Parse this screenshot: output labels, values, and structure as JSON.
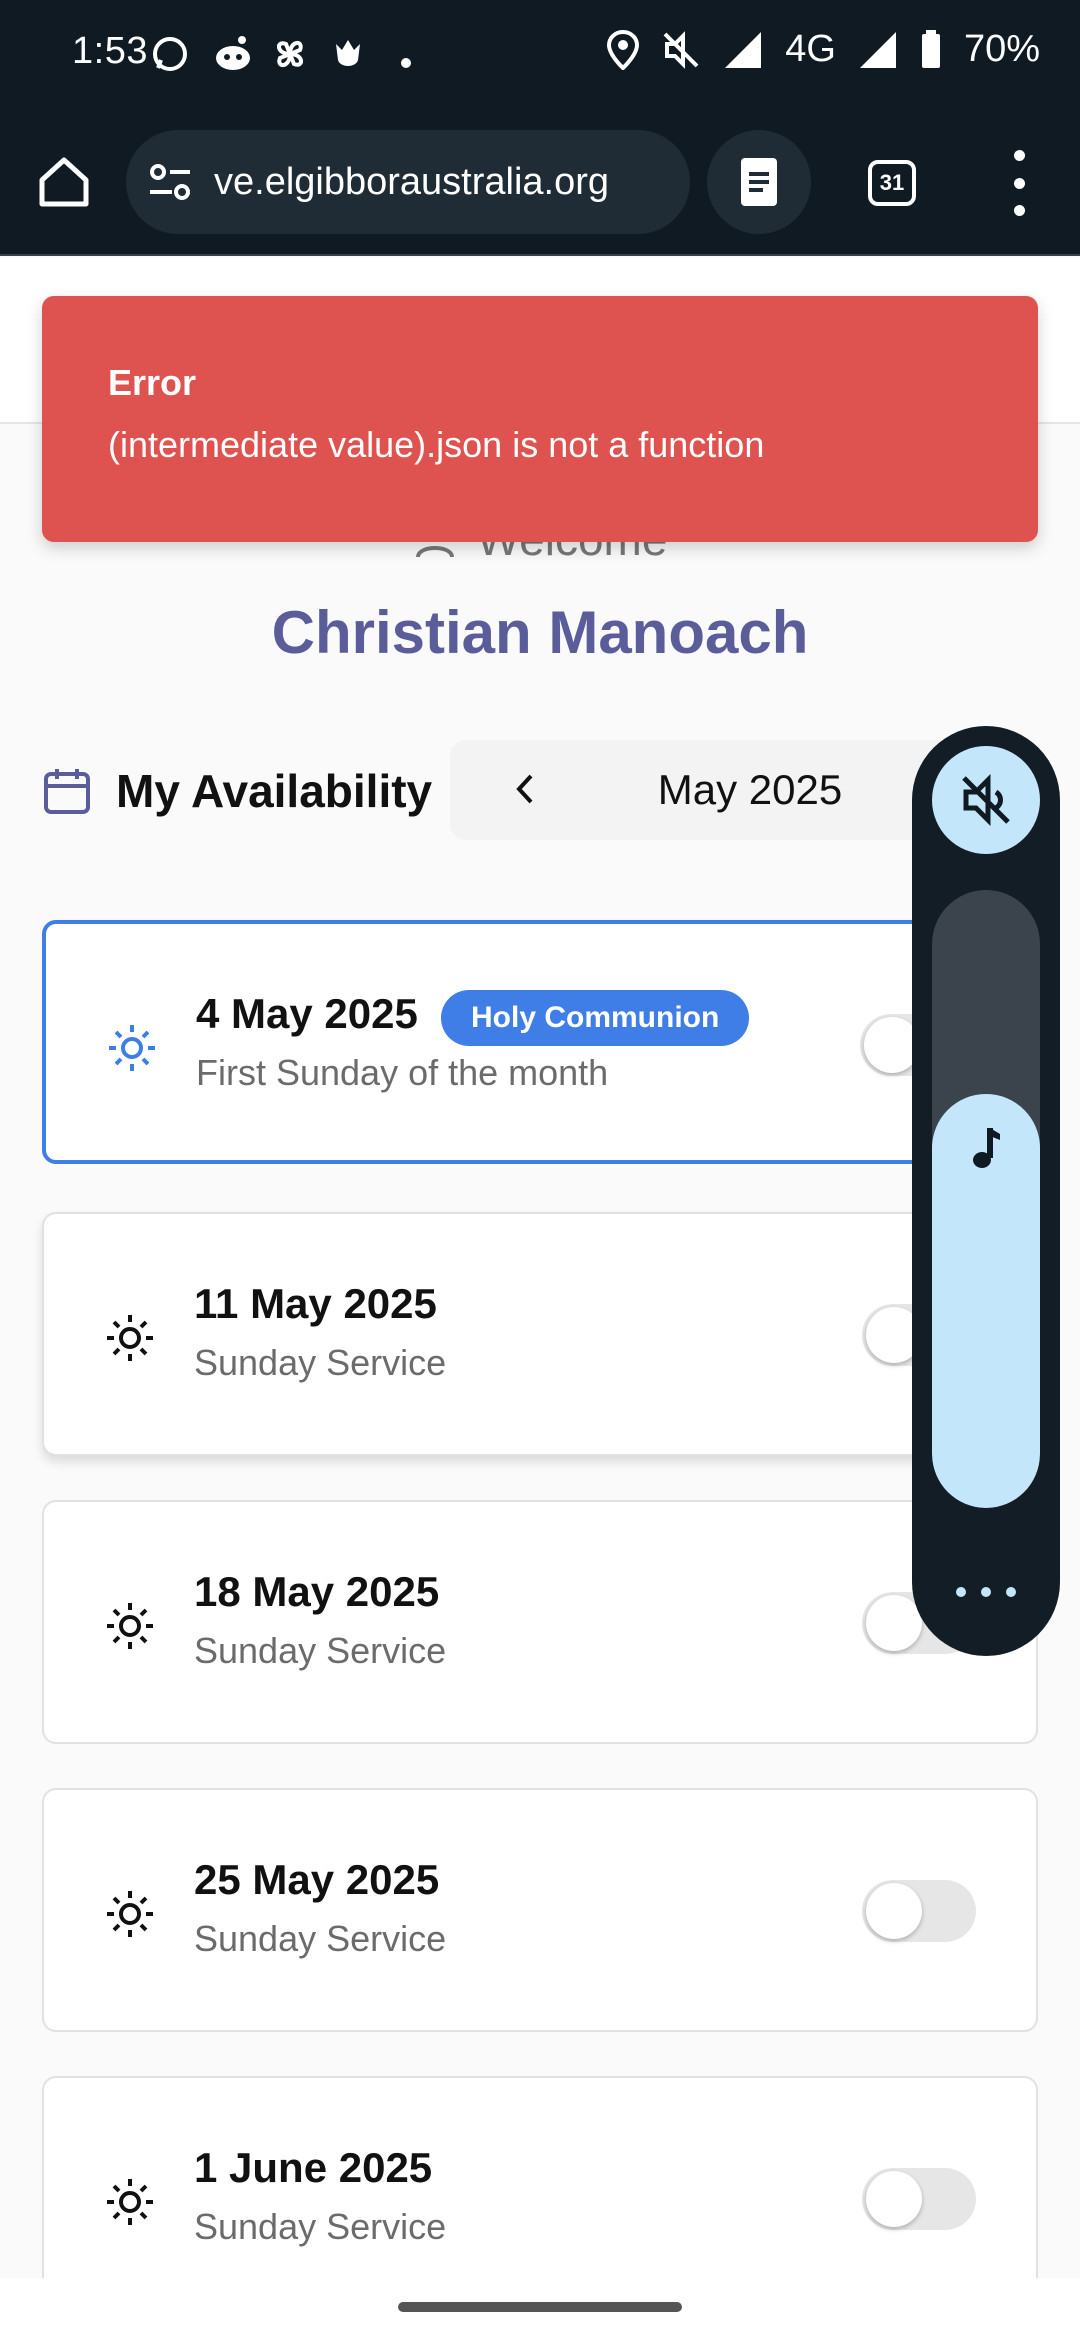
{
  "status_bar": {
    "time": "1:53",
    "network": "4G",
    "battery": "70%",
    "notification_icons": [
      "whatsapp-icon",
      "reddit-icon",
      "pinwheel-icon",
      "bug-icon",
      "dot-icon"
    ],
    "system_icons": [
      "location-icon",
      "vibrate-off-icon",
      "signal-icon",
      "battery-icon"
    ]
  },
  "browser": {
    "url": "ve.elgibboraustralia.org",
    "tab_count": "31"
  },
  "toast": {
    "title": "Error",
    "message": "(intermediate value).json is not a function",
    "color": "#de524f"
  },
  "welcome": {
    "label": "Welcome",
    "name": "Christian Manoach"
  },
  "availability": {
    "title": "My Availability",
    "month": "May 2025"
  },
  "services": [
    {
      "date": "4 May 2025",
      "badge": "Holy Communion",
      "subtitle": "First Sunday of the month",
      "enabled": false,
      "selected": true
    },
    {
      "date": "11 May 2025",
      "subtitle": "Sunday Service",
      "enabled": false,
      "selected": false
    },
    {
      "date": "18 May 2025",
      "subtitle": "Sunday Service",
      "enabled": false,
      "selected": false
    },
    {
      "date": "25 May 2025",
      "subtitle": "Sunday Service",
      "enabled": false,
      "selected": false
    },
    {
      "date": "1 June 2025",
      "subtitle": "Sunday Service",
      "enabled": false,
      "selected": false
    }
  ],
  "volume_panel": {
    "muted": true,
    "level_fraction": 0.67,
    "accent": "#c3e6fb"
  },
  "colors": {
    "accent_blue": "#3e7ee6",
    "name_purple": "#5b5d9a"
  }
}
